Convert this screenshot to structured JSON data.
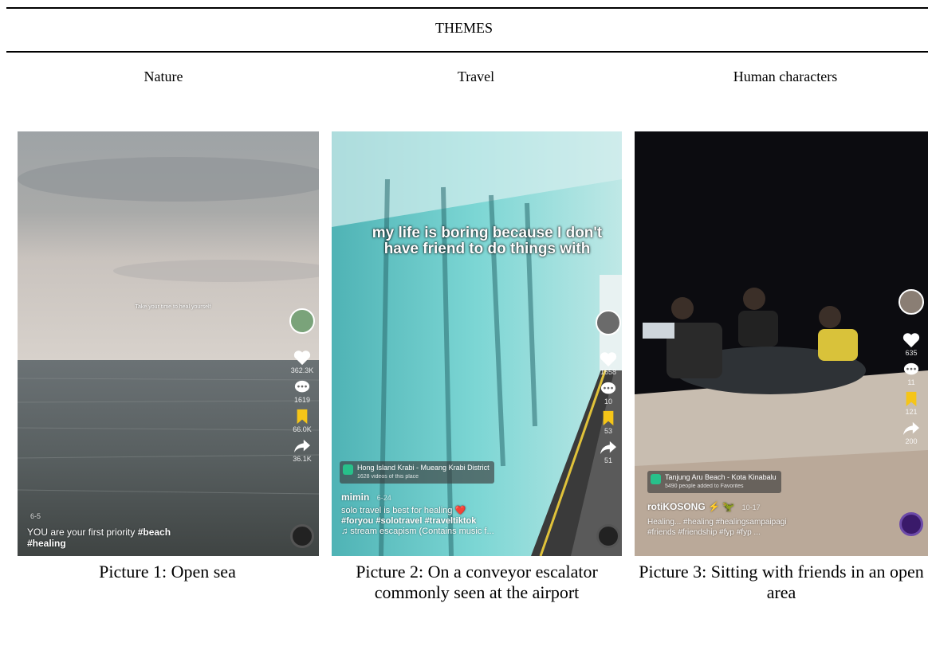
{
  "header": {
    "title": "THEMES"
  },
  "columns": [
    {
      "heading": "Nature",
      "caption": "Picture 1: Open sea"
    },
    {
      "heading": "Travel",
      "caption": "Picture 2: On a conveyor escalator commonly seen at the airport"
    },
    {
      "heading": "Human characters",
      "caption": "Picture 3: Sitting with friends in an open area"
    }
  ],
  "pic1": {
    "overlay_text": "Take your time to heal yourself",
    "counts": {
      "likes": "362.3K",
      "comments": "1619",
      "saves": "66.0K",
      "shares": "36.1K"
    },
    "date": "6-5",
    "caption_a": "YOU are your first priority ",
    "caption_b": "#beach",
    "caption_c": "#healing"
  },
  "pic2": {
    "overlay_text": "my life is boring because I don't have friend to do things with",
    "counts": {
      "likes": "1658",
      "comments": "10",
      "saves": "53",
      "shares": "51"
    },
    "location": "Hong Island Krabi - Mueang Krabi District",
    "location_sub": "1628 videos of this place",
    "username": "mimin",
    "date": "6-24",
    "caption_a": "solo travel is best for healing ❤️",
    "caption_b": "#foryou #solotravel #traveltiktok",
    "music": "♫ stream escapism (Contains music f..."
  },
  "pic3": {
    "counts": {
      "likes": "635",
      "comments": "11",
      "saves": "121",
      "shares": "200"
    },
    "location": "Tanjung Aru Beach - Kota Kinabalu",
    "location_sub": "5490 people added to Favorites",
    "username": "rotiKOSONG ⚡ 🦖",
    "date": "10-17",
    "caption_a": "Healing... #healing #healingsampaipagi",
    "caption_b": "#friends #friendship #fyp #fyp  ..."
  },
  "colors": {
    "like": "#ffffff",
    "save": "#f5c518",
    "location_pin": "#27c08a"
  }
}
